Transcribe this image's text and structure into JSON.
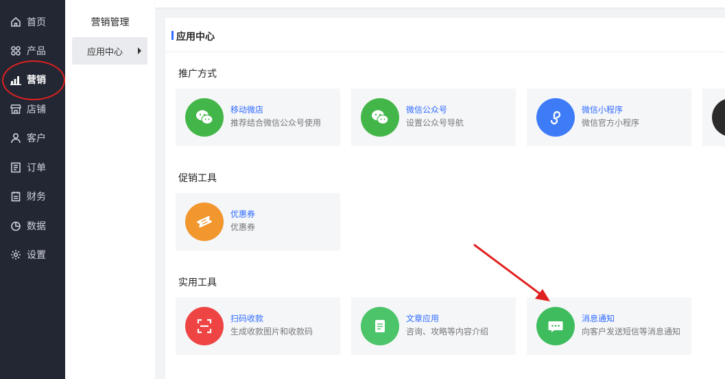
{
  "sidebar": {
    "items": [
      {
        "label": "首页",
        "icon": "home-icon"
      },
      {
        "label": "产品",
        "icon": "grid-icon"
      },
      {
        "label": "营销",
        "icon": "bar-chart-icon",
        "active": true
      },
      {
        "label": "店铺",
        "icon": "store-icon"
      },
      {
        "label": "客户",
        "icon": "user-icon"
      },
      {
        "label": "订单",
        "icon": "order-icon"
      },
      {
        "label": "财务",
        "icon": "clipboard-icon"
      },
      {
        "label": "数据",
        "icon": "pie-chart-icon"
      },
      {
        "label": "设置",
        "icon": "gear-icon"
      }
    ]
  },
  "subnav": {
    "title": "营销管理",
    "items": [
      {
        "label": "应用中心"
      }
    ]
  },
  "panel": {
    "title": "应用中心",
    "sections": [
      {
        "title": "推广方式",
        "cards": [
          {
            "name": "移动微店",
            "desc": "推荐结合微信公众号使用",
            "color": "#43b649",
            "icon": "wechat-icon"
          },
          {
            "name": "微信公众号",
            "desc": "设置公众号导航",
            "color": "#43b649",
            "icon": "wechat-icon"
          },
          {
            "name": "微信小程序",
            "desc": "微信官方小程序",
            "color": "#3d7bf7",
            "icon": "mini-program-icon"
          }
        ]
      },
      {
        "title": "促销工具",
        "cards": [
          {
            "name": "优惠券",
            "desc": "优惠券",
            "color": "#f2962e",
            "icon": "coupon-icon"
          }
        ]
      },
      {
        "title": "实用工具",
        "cards": [
          {
            "name": "扫码收款",
            "desc": "生成收款图片和收款码",
            "color": "#ee4444",
            "icon": "scan-icon"
          },
          {
            "name": "文章应用",
            "desc": "咨询、攻略等内容介绍",
            "color": "#4cc46a",
            "icon": "document-icon"
          },
          {
            "name": "消息通知",
            "desc": "向客户发送短信等消息通知",
            "color": "#3fbd5e",
            "icon": "message-icon"
          }
        ]
      }
    ]
  },
  "colors": {
    "accent": "#2f6bff",
    "sidebar_bg": "#232733",
    "annotation": "#e02020"
  }
}
